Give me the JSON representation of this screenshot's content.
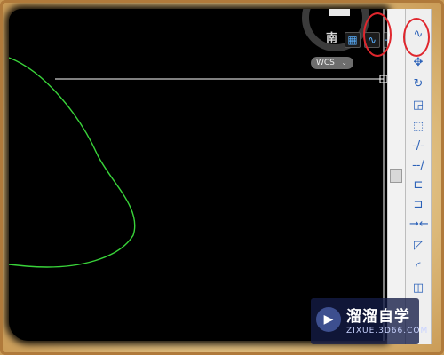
{
  "viewcube": {
    "direction_label": "南"
  },
  "ucs_badge": {
    "label": "WCS",
    "arrow": "⌄"
  },
  "toolbar_icons": {
    "grid": "▦",
    "polyline": "∿",
    "snap": "⊹",
    "spline_right": "∿"
  },
  "right_toolbar": [
    {
      "icon": "∿",
      "name": "spline-tool"
    },
    {
      "icon": "✥",
      "name": "move-tool"
    },
    {
      "icon": "↻",
      "name": "rotate-tool"
    },
    {
      "icon": "◲",
      "name": "scale-tool"
    },
    {
      "icon": "⬚",
      "name": "stretch-tool"
    },
    {
      "icon": "-/-",
      "name": "trim-tool"
    },
    {
      "icon": "--/",
      "name": "extend-tool"
    },
    {
      "icon": "⊏",
      "name": "break-at-point-tool"
    },
    {
      "icon": "⊐",
      "name": "break-tool"
    },
    {
      "icon": "→←",
      "name": "join-tool"
    },
    {
      "icon": "◸",
      "name": "chamfer-tool"
    },
    {
      "icon": "◜",
      "name": "fillet-tool"
    },
    {
      "icon": "◫",
      "name": "explode-tool"
    }
  ],
  "watermark": {
    "title": "溜溜自学",
    "url": "ZIXUE.3D66.COM",
    "logo_icon": "▶"
  },
  "colors": {
    "curve": "#39d33a",
    "crosshair": "#ffffff",
    "annotation": "#e0262d",
    "canvas": "#000000"
  }
}
